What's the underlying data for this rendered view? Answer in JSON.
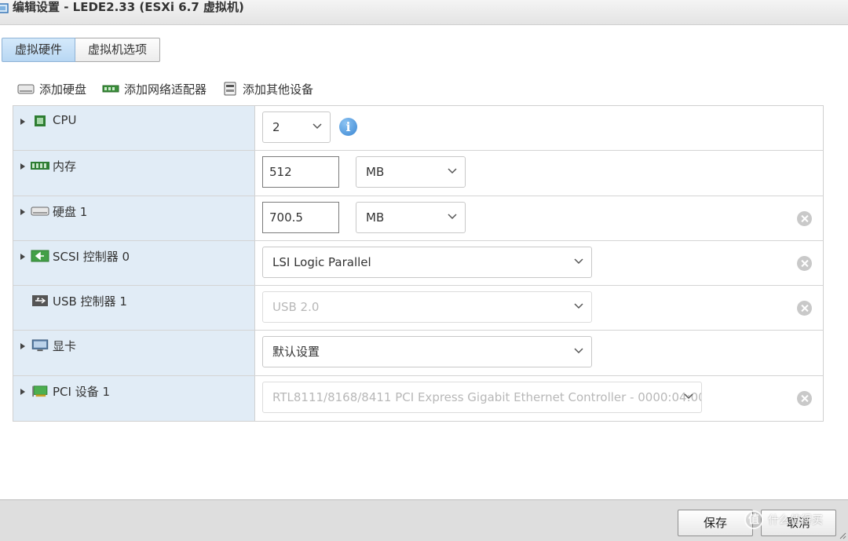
{
  "window": {
    "title": "编辑设置 - LEDE2.33 (ESXi 6.7 虚拟机)"
  },
  "tabs": [
    {
      "label": "虚拟硬件",
      "active": true
    },
    {
      "label": "虚拟机选项",
      "active": false
    }
  ],
  "toolbar": {
    "add_disk": "添加硬盘",
    "add_nic": "添加网络适配器",
    "add_other": "添加其他设备"
  },
  "devices": {
    "cpu": {
      "label": "CPU",
      "value": "2",
      "icon": "cpu-icon"
    },
    "memory": {
      "label": "内存",
      "value": "512",
      "unit": "MB",
      "icon": "memory-icon"
    },
    "disk": {
      "label": "硬盘 1",
      "value": "700.5",
      "unit": "MB",
      "icon": "harddisk-icon"
    },
    "scsi": {
      "label": "SCSI 控制器 0",
      "value": "LSI Logic Parallel",
      "icon": "scsi-controller-icon"
    },
    "usb": {
      "label": "USB 控制器 1",
      "value": "USB 2.0",
      "icon": "usb-icon"
    },
    "video": {
      "label": "显卡",
      "value": "默认设置",
      "icon": "display-icon"
    },
    "pci": {
      "label": "PCI 设备 1",
      "value": "RTL8111/8168/8411 PCI Express Gigabit Ethernet Controller - 0000:04:00",
      "icon": "pci-card-icon"
    }
  },
  "footer": {
    "save": "保存",
    "cancel": "取消"
  },
  "watermark": {
    "logo": "值",
    "text": "什么值得买"
  },
  "colors": {
    "left_cell": "#e1ecf6",
    "active_tab": "#b8d7f3",
    "info": "#3b87d3",
    "footer": "#dedede"
  }
}
